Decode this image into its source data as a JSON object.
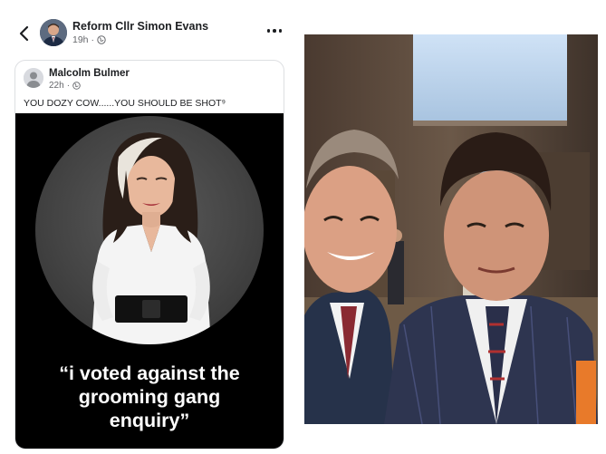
{
  "post": {
    "author_name": "Reform Cllr Simon Evans",
    "time": "19h",
    "privacy_icon": "globe-icon"
  },
  "shared_post": {
    "author_name": "Malcolm Bulmer",
    "time": "22h",
    "privacy_icon": "globe-icon",
    "text": "YOU DOZY COW......YOU SHOULD BE SHOT⁹"
  },
  "meme": {
    "quote_lines": [
      "“i voted against the",
      "grooming gang",
      "enquiry”"
    ]
  },
  "colors": {
    "meme_background": "#000000",
    "author_text": "#1c1e21",
    "meta_text": "#65676b"
  }
}
